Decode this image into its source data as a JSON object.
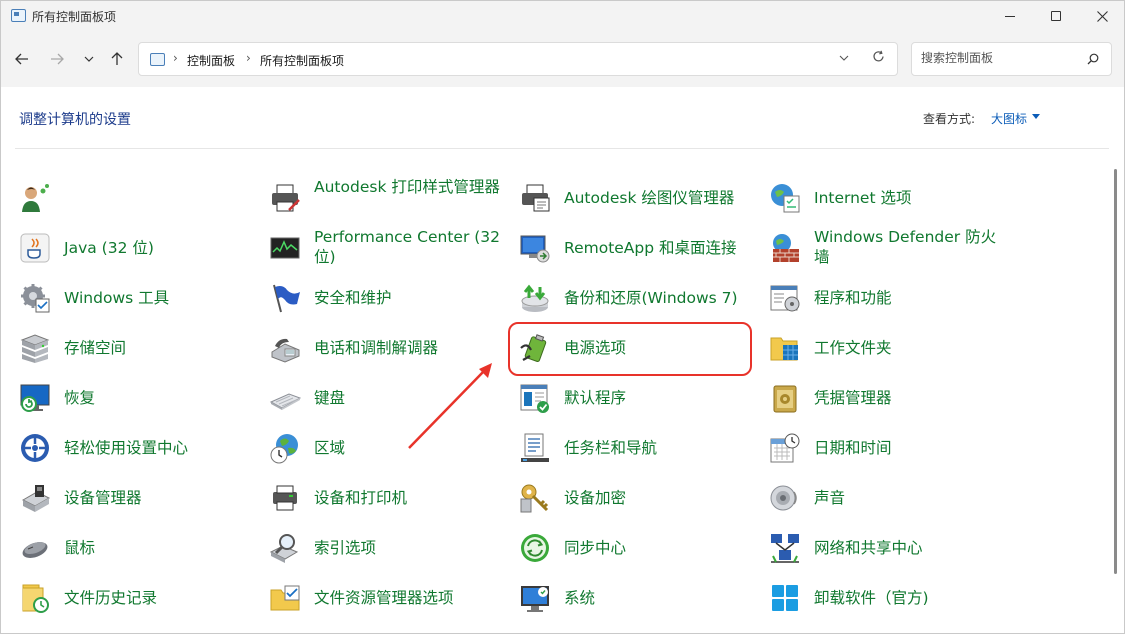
{
  "window": {
    "title": "所有控制面板项"
  },
  "nav": {
    "breadcrumbs": [
      "控制面板",
      "所有控制面板项"
    ],
    "search_placeholder": "搜索控制面板"
  },
  "header": {
    "title": "调整计算机的设置",
    "view_label": "查看方式:",
    "view_value": "大图标"
  },
  "items": [
    {
      "label": "",
      "icon": "user-accounts-icon"
    },
    {
      "label": "Autodesk 打印样式管理器",
      "icon": "printer-icon"
    },
    {
      "label": "Autodesk 绘图仪管理器",
      "icon": "plotter-icon"
    },
    {
      "label": "Internet 选项",
      "icon": "internet-options-icon"
    },
    {
      "label": "Java (32 位)",
      "icon": "java-icon"
    },
    {
      "label": "Performance Center (32 位)",
      "icon": "performance-icon"
    },
    {
      "label": "RemoteApp 和桌面连接",
      "icon": "remoteapp-icon"
    },
    {
      "label": "Windows Defender 防火墙",
      "icon": "firewall-icon"
    },
    {
      "label": "Windows 工具",
      "icon": "windows-tools-icon"
    },
    {
      "label": "安全和维护",
      "icon": "flag-icon"
    },
    {
      "label": "备份和还原(Windows 7)",
      "icon": "backup-icon"
    },
    {
      "label": "程序和功能",
      "icon": "programs-icon"
    },
    {
      "label": "存储空间",
      "icon": "storage-icon"
    },
    {
      "label": "电话和调制解调器",
      "icon": "phone-icon"
    },
    {
      "label": "电源选项",
      "icon": "power-icon"
    },
    {
      "label": "工作文件夹",
      "icon": "work-folders-icon"
    },
    {
      "label": "恢复",
      "icon": "recovery-icon"
    },
    {
      "label": "键盘",
      "icon": "keyboard-icon"
    },
    {
      "label": "默认程序",
      "icon": "default-programs-icon"
    },
    {
      "label": "凭据管理器",
      "icon": "credential-icon"
    },
    {
      "label": "轻松使用设置中心",
      "icon": "ease-of-access-icon"
    },
    {
      "label": "区域",
      "icon": "region-icon"
    },
    {
      "label": "任务栏和导航",
      "icon": "taskbar-icon"
    },
    {
      "label": "日期和时间",
      "icon": "datetime-icon"
    },
    {
      "label": "设备管理器",
      "icon": "device-manager-icon"
    },
    {
      "label": "设备和打印机",
      "icon": "devices-printers-icon"
    },
    {
      "label": "设备加密",
      "icon": "encryption-icon"
    },
    {
      "label": "声音",
      "icon": "sound-icon"
    },
    {
      "label": "鼠标",
      "icon": "mouse-icon"
    },
    {
      "label": "索引选项",
      "icon": "indexing-icon"
    },
    {
      "label": "同步中心",
      "icon": "sync-icon"
    },
    {
      "label": "网络和共享中心",
      "icon": "network-icon"
    },
    {
      "label": "文件历史记录",
      "icon": "file-history-icon"
    },
    {
      "label": "文件资源管理器选项",
      "icon": "explorer-options-icon"
    },
    {
      "label": "系统",
      "icon": "system-icon"
    },
    {
      "label": "卸载软件（官方)",
      "icon": "uninstall-icon"
    }
  ],
  "colors": {
    "link_green": "#10782f",
    "title_blue": "#1e3d8c",
    "highlight_red": "#e8332a"
  }
}
